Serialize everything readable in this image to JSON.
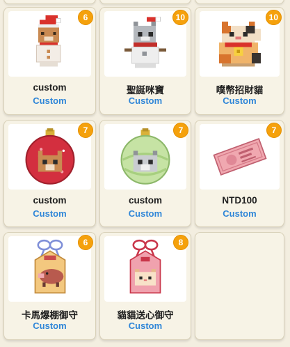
{
  "items": [
    {
      "name": "custom",
      "creator": "Custom",
      "count": "6",
      "icon": "snowman-cat-santa-hat-icon"
    },
    {
      "name": "聖誕咪寶",
      "creator": "Custom",
      "count": "10",
      "icon": "grey-cat-snowman-icon"
    },
    {
      "name": "噗幣招財貓",
      "creator": "Custom",
      "count": "10",
      "icon": "lucky-cat-coin-icon"
    },
    {
      "name": "custom",
      "creator": "Custom",
      "count": "7",
      "icon": "red-ornament-cat-icon"
    },
    {
      "name": "custom",
      "creator": "Custom",
      "count": "7",
      "icon": "green-ornament-cat-icon"
    },
    {
      "name": "NTD100",
      "creator": "Custom",
      "count": "7",
      "icon": "banknote-icon"
    },
    {
      "name": "卡馬爆棚御守",
      "creator": "Custom",
      "count": "6",
      "icon": "boar-omamori-icon"
    },
    {
      "name": "貓貓送心御守",
      "creator": "Custom",
      "count": "8",
      "icon": "cat-omamori-pink-icon"
    }
  ],
  "colors": {
    "background": "#f3eee0",
    "card": "#f7f3e6",
    "badge": "#f5a10c",
    "creator_text": "#2f86d8"
  }
}
